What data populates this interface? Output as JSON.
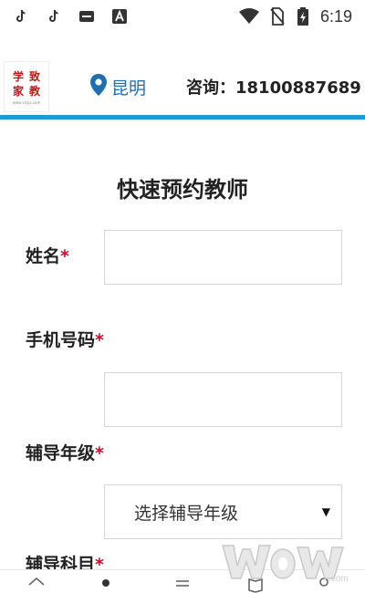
{
  "status_bar": {
    "time": "6:19",
    "icons": [
      "tiktok-icon",
      "tiktok-icon",
      "message-icon",
      "font-icon",
      "wifi-icon",
      "no-sim-icon",
      "battery-charging-icon"
    ]
  },
  "header": {
    "logo_chars": [
      "学",
      "致",
      "家",
      "教"
    ],
    "logo_url": "www.xnzjs.com",
    "location": "昆明",
    "consult": "咨询：18100887689",
    "accent_color": "#1e9ad4"
  },
  "form": {
    "title": "快速预约教师",
    "fields": [
      {
        "label": "姓名",
        "required": "*"
      },
      {
        "label": "手机号码",
        "required": "*"
      },
      {
        "label": "辅导年级",
        "required": "*",
        "selected": "选择辅导年级"
      },
      {
        "label": "辅导科目",
        "required": "*"
      }
    ]
  },
  "watermark": "WoWoZ.com"
}
